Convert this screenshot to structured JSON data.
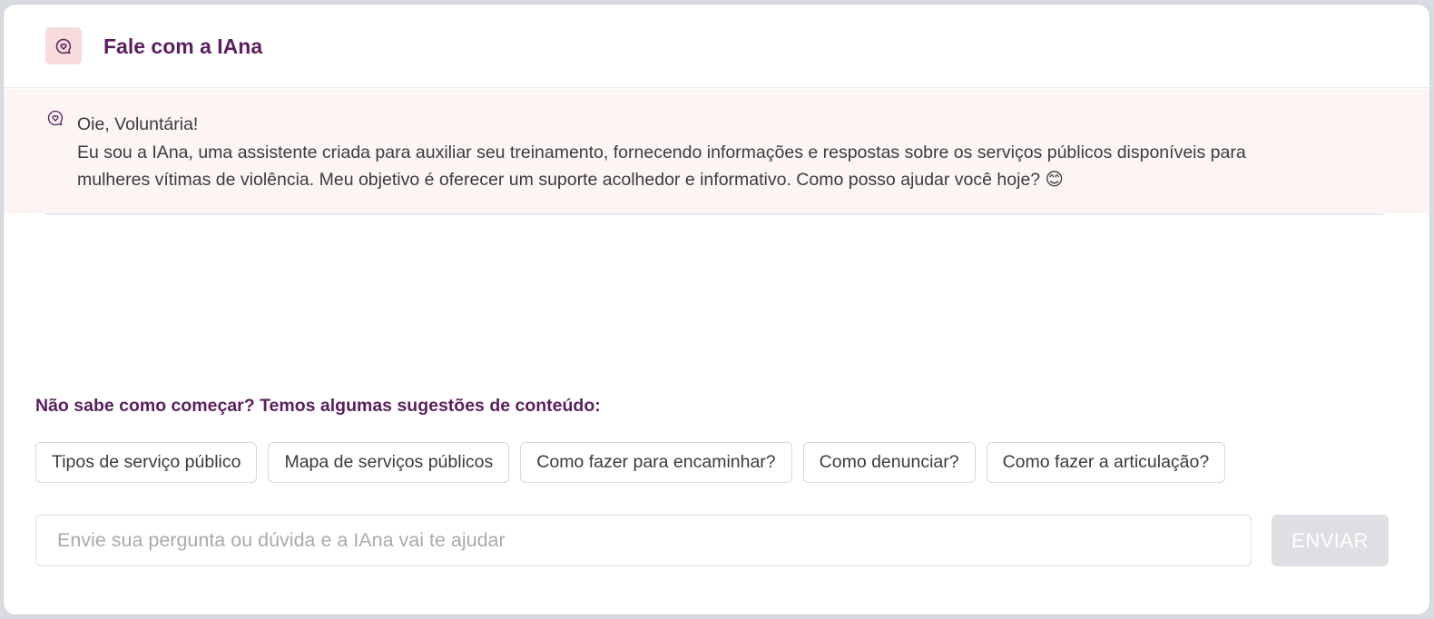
{
  "header": {
    "title": "Fale com a IAna",
    "icon": "chat-heart-icon",
    "icon_bg": "#f8dcdc"
  },
  "message": {
    "icon": "chat-heart-icon",
    "greeting": "Oie, Voluntária!",
    "body": "Eu sou a IAna, uma assistente criada para auxiliar seu treinamento, fornecendo informações e respostas sobre os serviços públicos disponíveis para mulheres vítimas de violência. Meu objetivo é oferecer um suporte acolhedor e informativo. Como posso ajudar você hoje? 😊",
    "bg": "#fcf5f4"
  },
  "suggestions": {
    "title": "Não sabe como começar? Temos algumas sugestões de conteúdo:",
    "chips": [
      "Tipos de serviço público",
      "Mapa de serviços públicos",
      "Como fazer para encaminhar?",
      "Como denunciar?",
      "Como fazer a articulação?"
    ]
  },
  "composer": {
    "placeholder": "Envie sua pergunta ou dúvida e a IAna vai te ajudar",
    "value": "",
    "send_label": "ENVIAR"
  },
  "colors": {
    "brand": "#5b1f5e",
    "text": "#3b3b40",
    "send_disabled": "#dedfe2"
  }
}
